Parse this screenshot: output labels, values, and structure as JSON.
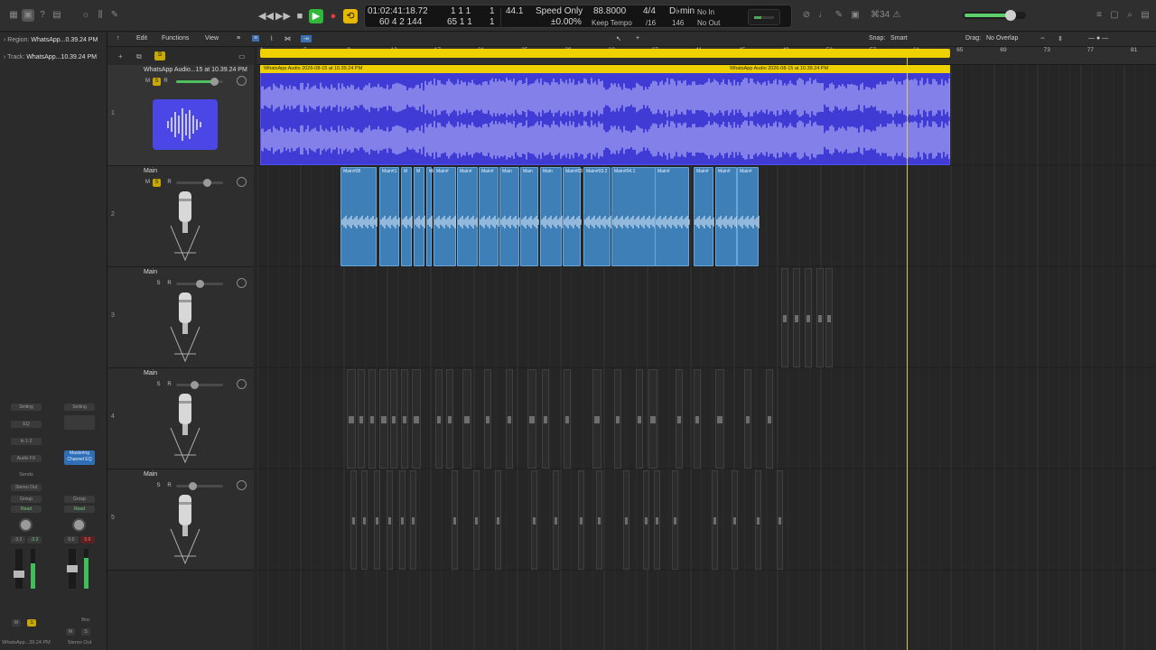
{
  "lcd": {
    "time": "01:02:41:18.72",
    "bars": "1 1 1",
    "beat_a": "1",
    "sample_rate": "44.1",
    "mode": "Speed Only",
    "speed": "88.8000",
    "timesig": "4/4",
    "key": "D♭min",
    "in": "No In",
    "row2_a": "60 4 2 144",
    "row2_b": "65 1 1",
    "row2_c": "1",
    "percent": "±0.00%",
    "keep_tempo": "Keep Tempo",
    "division": "/16",
    "tempo": "146",
    "out": "No Out"
  },
  "counter_badge": "⌘34",
  "inspector": {
    "region_label": "Region:",
    "region_value": "WhatsApp...0.39.24 PM",
    "track_label": "Track:",
    "track_value": "WhatsApp...10.39.24 PM",
    "strip1": {
      "setting": "Setting",
      "eq": "EQ",
      "input": "In 1-2",
      "audio_fx": "Audio FX",
      "sends": "Sends",
      "output": "Stereo Out",
      "group": "Group",
      "automation": "Read",
      "vol_a": "-3.3",
      "vol_b": "-3.3",
      "name": "WhatsApp...39.24 PM"
    },
    "strip2": {
      "setting": "Setting",
      "plugin": "Mastering Channel EQ",
      "group": "Group",
      "automation": "Read",
      "vol_a": "0.0",
      "vol_b": "0.6",
      "bnc": "Bnc",
      "name": "Stereo Out"
    }
  },
  "localbar": {
    "edit": "Edit",
    "functions": "Functions",
    "view": "View",
    "snap_label": "Snap:",
    "snap_value": "Smart",
    "drag_label": "Drag:",
    "drag_value": "No Overlap"
  },
  "ruler": [
    "1",
    "5",
    "9",
    "13",
    "17",
    "21",
    "25",
    "29",
    "33",
    "37",
    "41",
    "45",
    "49",
    "53",
    "57",
    "61",
    "65",
    "69",
    "73",
    "77",
    "81"
  ],
  "tracks": [
    {
      "num": "1",
      "name": "WhatsApp Audio...15 at 10.39.24 PM"
    },
    {
      "num": "2",
      "name": "Main"
    },
    {
      "num": "3",
      "name": "Main"
    },
    {
      "num": "4",
      "name": "Main"
    },
    {
      "num": "5",
      "name": "Main"
    }
  ],
  "top_region_title": "WhatsApp Audio 2026-08-15 at 10.39.24 PM",
  "top_region_title2": "WhatsApp Audio 2026-08-15 at 10.39.24 PM",
  "blue_regions": [
    "Main#08",
    "Main#1",
    "M",
    "M",
    "Main",
    "Main#",
    "Main#",
    "Main#",
    "Main",
    "Main",
    "Main",
    "Main#03",
    "Main#03.2",
    "Main#04.1",
    "Main#",
    "Main#",
    "Main#",
    "Main#"
  ],
  "colors": {
    "accent_yellow": "#f0d100",
    "region_purple": "#3f3bd4",
    "region_blue": "#3e7fb8"
  }
}
